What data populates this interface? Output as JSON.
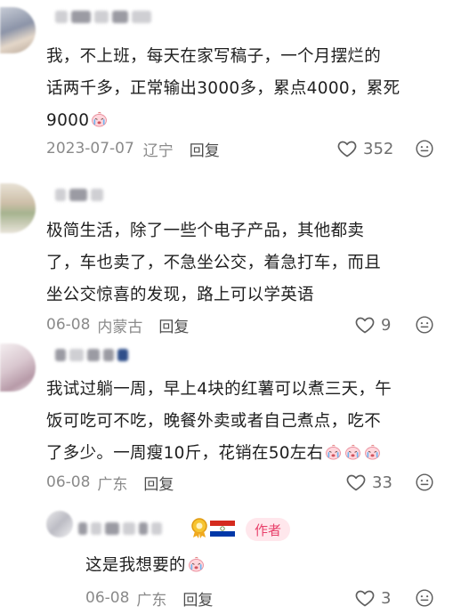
{
  "comments": [
    {
      "text": "我，不上班，每天在家写稿子，一个月摆烂的话两千多，正常输出3000多，累点4000，累死9000",
      "text_lines": [
        "我，不上班，每天在家写稿子，一个月摆烂的",
        "话两千多，正常输出3000多，累点4000，累死",
        "9000"
      ],
      "date": "2023-07-07",
      "location": "辽宁",
      "reply_label": "回复",
      "likes": "352"
    },
    {
      "text_lines": [
        "极简生活，除了一些个电子产品，其他都卖",
        "了，车也卖了，不急坐公交，着急打车，而且",
        "坐公交惊喜的发现，路上可以学英语"
      ],
      "date": "06-08",
      "location": "内蒙古",
      "reply_label": "回复",
      "likes": "9"
    },
    {
      "text_lines": [
        "我试过躺一周，早上4块的红薯可以煮三天，午",
        "饭可吃可不吃，晚餐外卖或者自己煮点，吃不",
        "了多少。一周瘦10斤，花销在50左右"
      ],
      "date": "06-08",
      "location": "广东",
      "reply_label": "回复",
      "likes": "33"
    }
  ],
  "reply": {
    "author_tag": "作者",
    "text": "这是我想要的",
    "date": "06-08",
    "location": "广东",
    "reply_label": "回复",
    "likes": "3"
  },
  "icons": {
    "like": "heart-outline-icon",
    "more": "emoji-face-outline-icon",
    "inline_emoji": "crying-face-emoji",
    "badge": "gold-medal-badge-icon",
    "flag": "paraguay-flag-icon"
  },
  "colors": {
    "author_tag_bg": "#ffe7ec",
    "author_tag_text": "#e8406a",
    "meta_text": "#8a8a8a"
  }
}
